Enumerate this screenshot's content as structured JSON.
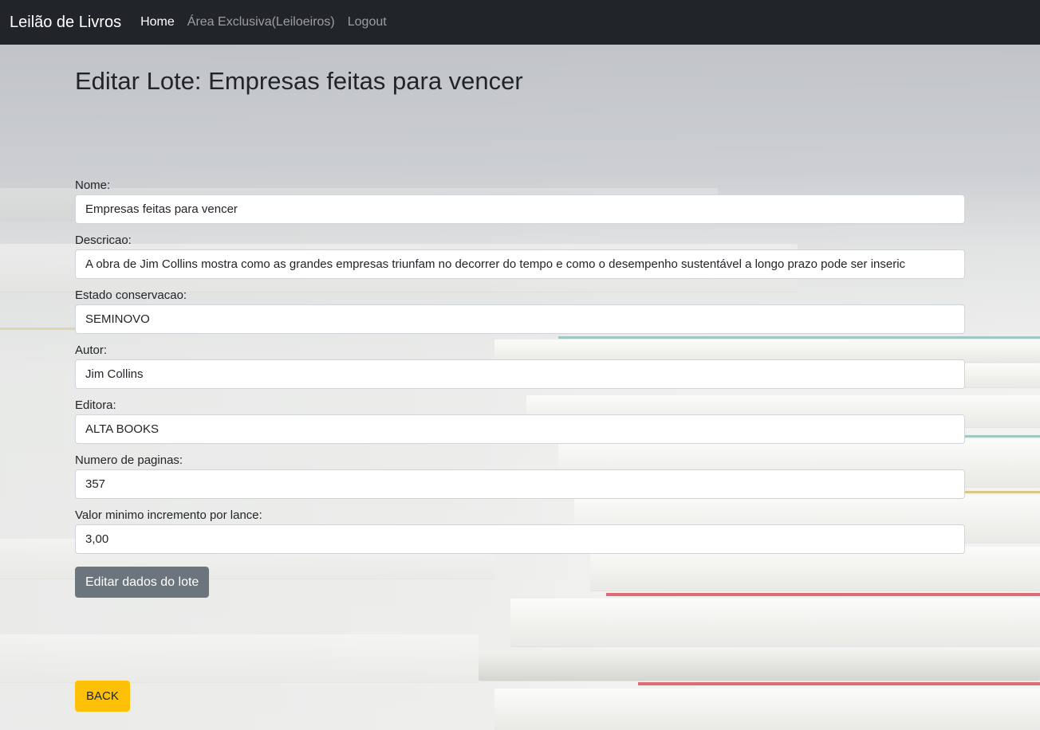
{
  "navbar": {
    "brand": "Leilão de Livros",
    "links": [
      "Home",
      "Área Exclusiva(Leiloeiros)",
      "Logout"
    ]
  },
  "page": {
    "title": "Editar Lote: Empresas feitas para vencer"
  },
  "form": {
    "fields": [
      {
        "label": "Nome:",
        "value": "Empresas feitas para vencer"
      },
      {
        "label": "Descricao:",
        "value": "A obra de Jim Collins mostra como as grandes empresas triunfam no decorrer do tempo e como o desempenho sustentável a longo prazo pode ser inseric"
      },
      {
        "label": "Estado conservacao:",
        "value": "SEMINOVO"
      },
      {
        "label": "Autor:",
        "value": "Jim Collins"
      },
      {
        "label": "Editora:",
        "value": "ALTA BOOKS"
      },
      {
        "label": "Numero de paginas:",
        "value": "357"
      },
      {
        "label": "Valor minimo incremento por lance:",
        "value": "3,00"
      }
    ],
    "submit_label": "Editar dados do lote",
    "back_label": "BACK"
  },
  "colors": {
    "navbar_bg": "#212529",
    "submit_bg": "#6c757d",
    "back_bg": "#ffc107"
  }
}
